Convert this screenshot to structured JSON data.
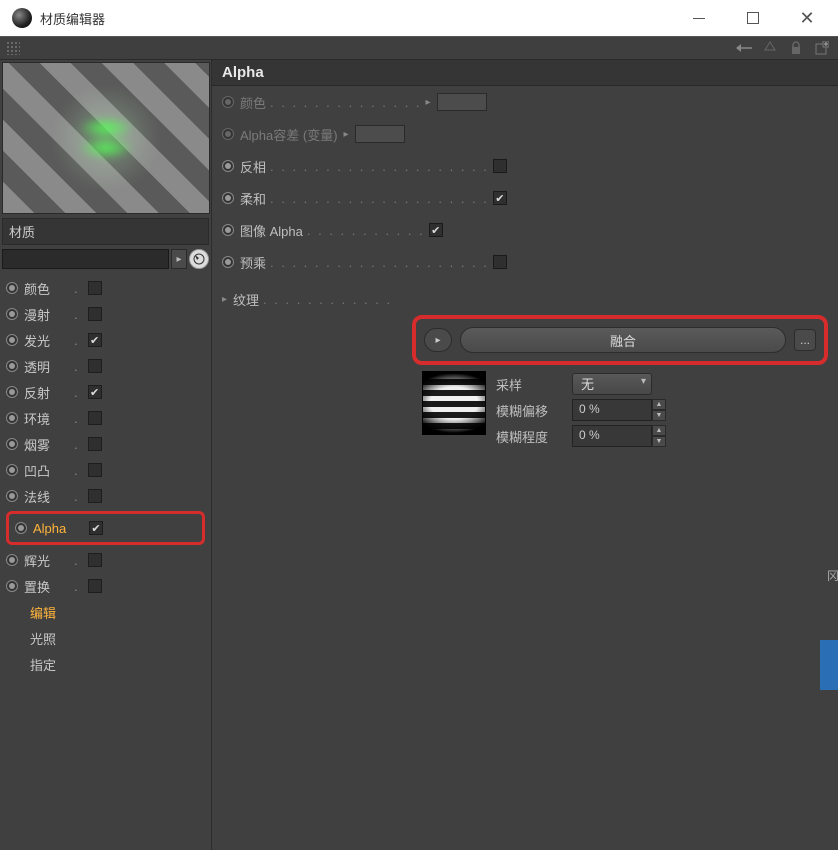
{
  "window": {
    "title": "材质编辑器"
  },
  "left": {
    "mat_label": "材质",
    "channels": [
      {
        "label": "颜色",
        "checked": false
      },
      {
        "label": "漫射",
        "checked": false
      },
      {
        "label": "发光",
        "checked": true
      },
      {
        "label": "透明",
        "checked": false
      },
      {
        "label": "反射",
        "checked": true
      },
      {
        "label": "环境",
        "checked": false
      },
      {
        "label": "烟雾",
        "checked": false
      },
      {
        "label": "凹凸",
        "checked": false
      },
      {
        "label": "法线",
        "checked": false
      }
    ],
    "alpha": {
      "label": "Alpha",
      "checked": true
    },
    "channels2": [
      {
        "label": "辉光",
        "checked": false
      },
      {
        "label": "置换",
        "checked": false
      }
    ],
    "subs": [
      {
        "label": "编辑",
        "active": true
      },
      {
        "label": "光照",
        "active": false
      },
      {
        "label": "指定",
        "active": false
      }
    ]
  },
  "panel": {
    "title": "Alpha",
    "rows": {
      "color": {
        "label": "颜色"
      },
      "tol": {
        "label": "Alpha容差 (变量)"
      },
      "invert": {
        "label": "反相",
        "checked": false
      },
      "soft": {
        "label": "柔和",
        "checked": true
      },
      "imgalpha": {
        "label": "图像 Alpha",
        "checked": true
      },
      "premul": {
        "label": "预乘",
        "checked": false
      },
      "texture": {
        "label": "纹理",
        "value": "融合",
        "ellipsis": "..."
      },
      "sample": {
        "label": "采样",
        "value": "无"
      },
      "bluroff": {
        "label": "模糊偏移",
        "value": "0 %"
      },
      "blurstr": {
        "label": "模糊程度",
        "value": "0 %"
      }
    }
  },
  "edge_char": "冈"
}
